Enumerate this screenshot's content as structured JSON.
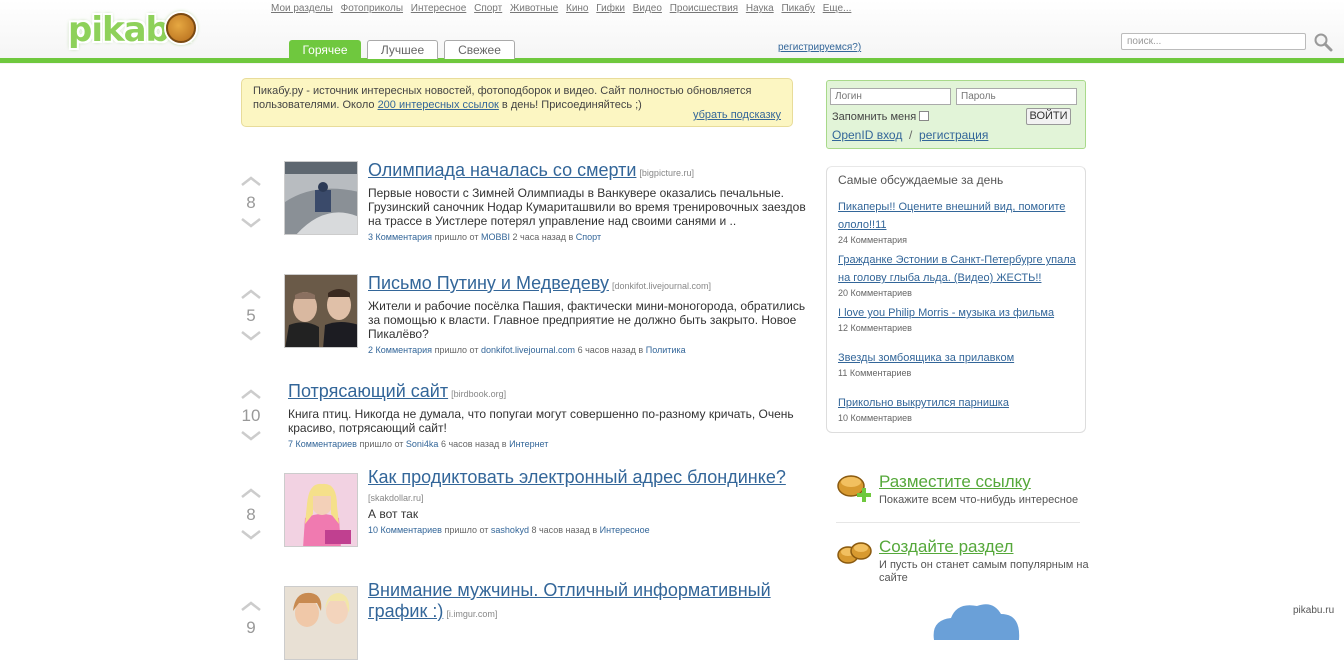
{
  "header": {
    "logo_text": "pikabu",
    "nav": [
      "Мои разделы",
      "Фотоприколы",
      "Интересное",
      "Спорт",
      "Животные",
      "Кино",
      "Гифки",
      "Видео",
      "Происшествия",
      "Наука",
      "Пикабу",
      "Еще..."
    ],
    "tabs": [
      "Горячее",
      "Лучшее",
      "Свежее"
    ],
    "register_label": "регистрируемся?)",
    "search_placeholder": "поиск...",
    "accent_color": "#6fc83e"
  },
  "hint": {
    "text_before": "Пикабу.ру - источник интересных новостей, фотоподборок и видео. Сайт полностью обновляется пользователями. Около ",
    "link": "200 интересных ссылок",
    "text_after": " в день! Присоединяйтесь ;)",
    "hide_label": "убрать подсказку"
  },
  "stories": [
    {
      "votes": "8",
      "title": "Олимпиада началась со смерти",
      "domain": "[bigpicture.ru]",
      "text": "Первые новости с Зимней Олимпиады в Ванкувере оказались печальные. Грузинский саночник Нодар Кумариташвили во время тренировочных заездов на трассе в Уистлере потерял управление над своими санями и ..",
      "comments": "3 Комментария",
      "from_label": "пришло от",
      "author": "MOBBI",
      "time": "2 часа назад в",
      "category": "Спорт"
    },
    {
      "votes": "5",
      "title": "Письмо Путину и Медведеву",
      "domain": "[donkifot.livejournal.com]",
      "text": "Жители и рабочие посёлка Пашия, фактически мини-моногорода, обратились за помощью к власти. Главное предприятие не должно быть закрыто. Новое Пикалёво?",
      "comments": "2 Комментария",
      "from_label": "пришло от",
      "author": "donkifot.livejournal.com",
      "time": "6 часов назад в",
      "category": "Политика"
    },
    {
      "votes": "10",
      "title": "Потрясающий сайт",
      "domain": "[birdbook.org]",
      "text": "Книга птиц. Никогда не думала, что попугаи могут совершенно по-разному кричать, Очень красиво, потрясающий сайт!",
      "comments": "7 Комментариев",
      "from_label": "пришло от",
      "author": "Soni4ka",
      "time": "6 часов назад в",
      "category": "Интернет"
    },
    {
      "votes": "8",
      "title": "Как продиктовать электронный адрес блондинке?",
      "domain": "[skakdollar.ru]",
      "text": "А вот так",
      "comments": "10 Комментариев",
      "from_label": "пришло от",
      "author": "sashokyd",
      "time": "8 часов назад в",
      "category": "Интересное"
    },
    {
      "votes": "9",
      "title": "Внимание мужчины. Отличный информативный график :)",
      "domain": "[i.imgur.com]"
    }
  ],
  "login": {
    "login_placeholder": "Логин",
    "password_placeholder": "Пароль",
    "remember_label": "Запомнить меня",
    "submit_label": "ВОЙТИ",
    "openid_label": "OpenID вход",
    "separator": "/",
    "register_label": "регистрация"
  },
  "discussed": {
    "title": "Самые обсуждаемые за день",
    "items": [
      {
        "title": "Пикаперы!! Оцените внешний вид, помогите ололо!!11",
        "comments": "24 Комментария"
      },
      {
        "title": "Гражданке Эстонии в Санкт-Петербурге упала на голову глыба льда. (Видео) ЖЕСТЬ!!",
        "comments": "20 Комментариев"
      },
      {
        "title": "I love you Philip Morris - музыка из фильма",
        "comments": "12 Комментариев"
      },
      {
        "title": "Звезды зомбоящика за прилавком",
        "comments": "11 Комментариев"
      },
      {
        "title": "Прикольно выкрутился парнишка",
        "comments": "10 Комментариев"
      }
    ]
  },
  "promo": [
    {
      "title": "Разместите ссылку",
      "desc": "Покажите всем что-нибудь интересное"
    },
    {
      "title": "Создайте раздел",
      "desc": "И пусть он станет самым популярным на сайте"
    }
  ],
  "watermark": "pikabu.ru"
}
